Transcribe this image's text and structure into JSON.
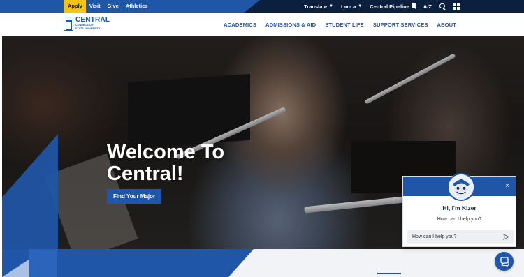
{
  "utility": {
    "left_links": [
      {
        "label": "Apply",
        "name": "util-apply-link",
        "highlight": true
      },
      {
        "label": "Visit",
        "name": "util-visit-link"
      },
      {
        "label": "Give",
        "name": "util-give-link"
      },
      {
        "label": "Athletics",
        "name": "util-athletics-link"
      }
    ],
    "translate_label": "Translate",
    "iam_label": "I am a",
    "pipeline_label": "Central Pipeline",
    "az_label": "A/Z"
  },
  "logo": {
    "name": "CENTRAL",
    "subtitle_lines": [
      "CONNECTICUT",
      "STATE UNIVERSITY"
    ]
  },
  "nav": {
    "items": [
      {
        "label": "ACADEMICS",
        "name": "nav-academics"
      },
      {
        "label": "ADMISSIONS & AID",
        "name": "nav-admissions-aid"
      },
      {
        "label": "STUDENT LIFE",
        "name": "nav-student-life"
      },
      {
        "label": "SUPPORT SERVICES",
        "name": "nav-support-services"
      },
      {
        "label": "ABOUT",
        "name": "nav-about"
      }
    ]
  },
  "hero": {
    "title": "Welcome To Central!",
    "cta": "Find Your Major"
  },
  "chat": {
    "close_glyph": "×",
    "title": "Hi, I'm Kizer",
    "prompt": "How can I help you?",
    "input_placeholder": "How can I help you?"
  },
  "colors": {
    "brand_blue": "#1f56a8",
    "navy": "#0b1f3f",
    "apply_yellow": "#f3c418"
  },
  "icons": {
    "translate": "chevron-down-icon",
    "pipeline": "bookmark-icon",
    "search": "search-icon",
    "apps": "grid-icon",
    "send": "send-icon",
    "chat_fab": "chat-bubble-icon"
  }
}
